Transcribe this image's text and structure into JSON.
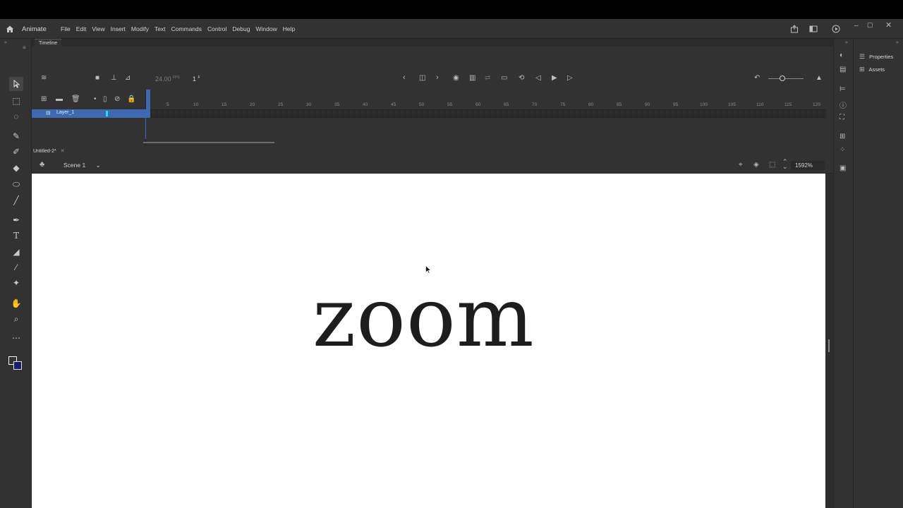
{
  "app": {
    "name": "Animate"
  },
  "menus": [
    "File",
    "Edit",
    "View",
    "Insert",
    "Modify",
    "Text",
    "Commands",
    "Control",
    "Debug",
    "Window",
    "Help"
  ],
  "timeline": {
    "tab_label": "Timeline",
    "fps": "24.00",
    "fps_unit": "FPS",
    "frame": "1",
    "frame_unit": "F",
    "layer_name": "Layer_1",
    "ticks": [
      "5",
      "10",
      "15",
      "20",
      "25",
      "30",
      "35",
      "40",
      "45",
      "50",
      "55",
      "60",
      "65",
      "70",
      "75",
      "80",
      "85",
      "90",
      "95",
      "100",
      "105",
      "110",
      "115",
      "120"
    ]
  },
  "document": {
    "tab_label": "Untitled-2*",
    "scene_label": "Scene 1",
    "zoom": "1592%",
    "stage_text": "zoom"
  },
  "panels": {
    "properties_label": "Properties",
    "assets_label": "Assets"
  },
  "colors": {
    "accent": "#3d6bb3",
    "layer_swatch": "#2bd9f5",
    "ui_bg": "#323232",
    "stage_bg": "#ffffff"
  },
  "icons": {
    "home": "home-icon",
    "play": "play-icon",
    "selection": "selection-tool-icon",
    "text": "text-tool-icon",
    "hand": "hand-tool-icon",
    "zoom": "zoom-tool-icon"
  }
}
